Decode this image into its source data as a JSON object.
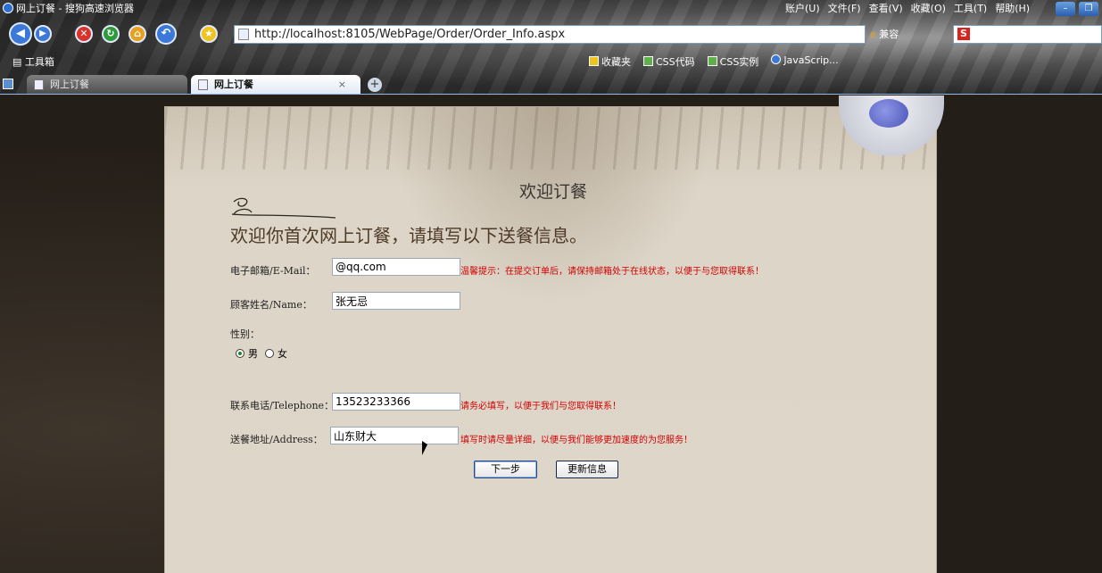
{
  "browser": {
    "window_title": "网上订餐 - 搜狗高速浏览器",
    "menus": [
      "账户(U)",
      "文件(F)",
      "查看(V)",
      "收藏(O)",
      "工具(T)",
      "帮助(H)"
    ],
    "address": "http://localhost:8105/WebPage/Order/Order_Info.aspx",
    "compat_label": "兼容",
    "toolbox_label": "工具箱",
    "favorites": [
      "收藏夹",
      "CSS代码",
      "CSS实例",
      "JavaScrip..."
    ],
    "tabs": [
      {
        "label": "网上订餐",
        "active": false
      },
      {
        "label": "网上订餐",
        "active": true
      }
    ],
    "tab_close_glyph": "×"
  },
  "page": {
    "heading": "欢迎订餐",
    "subheading": "欢迎你首次网上订餐，请填写以下送餐信息。",
    "fields": {
      "email": {
        "label": "电子邮箱/E-Mail：",
        "value": "@qq.com",
        "hint": "温馨提示：在提交订单后，请保持邮箱处于在线状态，以便于与您取得联系！"
      },
      "name": {
        "label": "顾客姓名/Name：",
        "value": "张无忌"
      },
      "gender": {
        "label": "性别：",
        "options": [
          "男",
          "女"
        ],
        "selected": "男"
      },
      "telephone": {
        "label": "联系电话/Telephone：",
        "value": "13523233366",
        "hint": "请务必填写，以便于我们与您取得联系！"
      },
      "address": {
        "label": "送餐地址/Address：",
        "value": "山东财大",
        "hint": "填写时请尽量详细，以便与我们能够更加速度的为您服务！"
      }
    },
    "buttons": {
      "next": "下一步",
      "update": "更新信息"
    }
  }
}
